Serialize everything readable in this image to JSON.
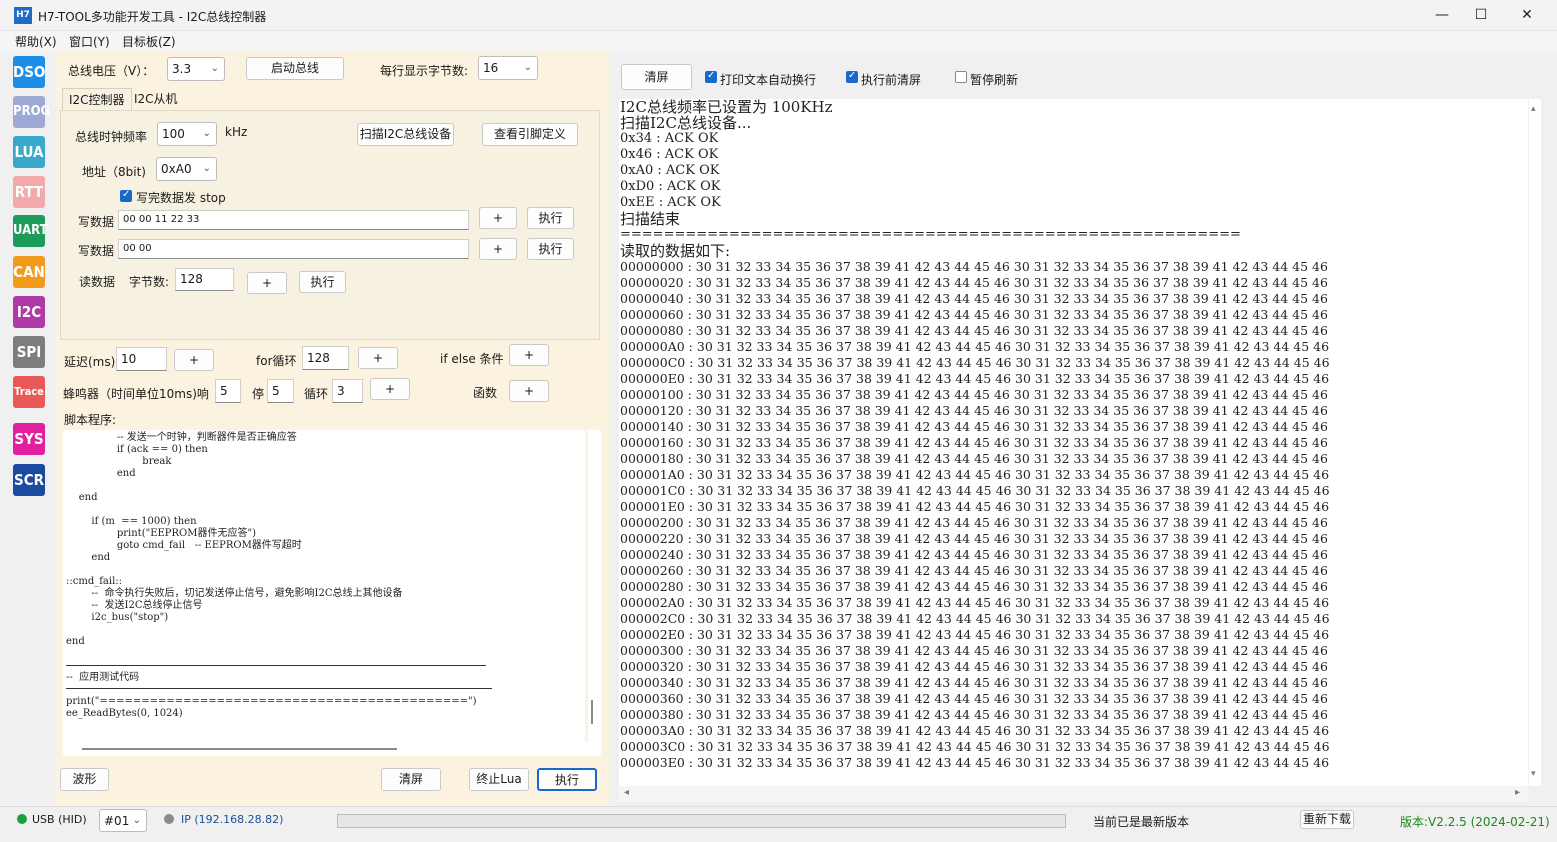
{
  "window": {
    "icon_text": "H7",
    "title": "H7-TOOL多功能开发工具 - I2C总线控制器",
    "minimize": "—",
    "maximize": "☐",
    "close": "✕"
  },
  "menu": [
    "帮助(X)",
    "窗口(Y)",
    "目标板(Z)"
  ],
  "sidebar": [
    {
      "label": "DSO",
      "color": "#1b8ee8"
    },
    {
      "label": "PROG",
      "color": "#9ea9d6"
    },
    {
      "label": "LUA",
      "color": "#3aa9c9"
    },
    {
      "label": "RTT",
      "color": "#f2a9a9"
    },
    {
      "label": "UART",
      "color": "#1c9c56"
    },
    {
      "label": "CAN",
      "color": "#f29a1a"
    },
    {
      "label": "I2C",
      "color": "#b03aa5"
    },
    {
      "label": "SPI",
      "color": "#7d7d7d"
    },
    {
      "label": "Trace",
      "color": "#e85a5a"
    },
    {
      "label": "SYS",
      "color": "#e21f9c"
    },
    {
      "label": "SCR",
      "color": "#1b4aa0"
    }
  ],
  "top": {
    "voltage_label": "总线电压（V）：",
    "voltage_value": "3.3",
    "start_bus": "启动总线",
    "bytes_per_line_label": "每行显示字节数:",
    "bytes_per_line_value": "16"
  },
  "tabs": [
    "I2C控制器",
    "I2C从机"
  ],
  "controller": {
    "clock_label": "总线时钟频率",
    "clock_value": "100",
    "clock_unit": "kHz",
    "scan_button": "扫描I2C总线设备",
    "pin_button": "查看引脚定义",
    "addr_label": "地址（8bit)",
    "addr_value": "0xA0",
    "stop_label": "写完数据发 stop",
    "write1_label": "写数据",
    "write1_value": "00 00 11 22 33",
    "write2_label": "写数据",
    "write2_value": "00 00",
    "read_label": "读数据",
    "read_bytes_label": "字节数:",
    "read_bytes_value": "128",
    "plus": "+",
    "exec": "执行"
  },
  "script_tools": {
    "delay_label": "延迟(ms)",
    "delay_value": "10",
    "for_label": "for循环",
    "for_value": "128",
    "if_label": "if else 条件",
    "buzzer_label": "蜂鸣器（时间单位10ms)响",
    "buzzer_on": "5",
    "stop_label": "停",
    "stop_value": "5",
    "loop_label": "循环",
    "loop_value": "3",
    "func_label": "函数",
    "plus": "+",
    "script_title": "脚本程序:"
  },
  "script_lines": [
    "                -- 发送一个时钟，判断器件是否正确应答",
    "                if (ack == 0) then",
    "                        break",
    "                end",
    "",
    "    end",
    "",
    "        if (m  == 1000) then",
    "                print(\"EEPROM器件无应答\")",
    "                goto cmd_fail   -- EEPROM器件写超时",
    "        end",
    "",
    "::cmd_fail::",
    "        --  命令执行失败后，切记发送停止信号，避免影响I2C总线上其他设备",
    "        --  发送I2C总线停止信号",
    "        i2c_bus(\"stop\")",
    "",
    "end",
    "",
    "",
    "--  应用测试代码",
    "",
    "print(\"============================================\")",
    "ee_ReadBytes(0, 1024)"
  ],
  "bottom_left": {
    "wave": "波形",
    "clear": "清屏",
    "stop_lua": "终止Lua",
    "exec": "执行"
  },
  "output_toolbar": {
    "clear": "清屏",
    "wrap": "打印文本自动换行",
    "clear_before": "执行前清屏",
    "pause": "暂停刷新"
  },
  "output_header": [
    "I2C总线频率已设置为 100KHz",
    "扫描I2C总线设备...",
    "0x34 : ACK OK",
    "0x46 : ACK OK",
    "0xA0 : ACK OK",
    "0xD0 : ACK OK",
    "0xEE : ACK OK",
    "扫描结束",
    "=========================================================",
    "读取的数据如下:"
  ],
  "hex_bytes": "30 31 32 33 34 35 36 37 38 39 41 42 43 44 45 46 30 31 32 33 34 35 36 37 38 39 41 42 43 44 45 46",
  "hex_addresses": [
    "00000000",
    "00000020",
    "00000040",
    "00000060",
    "00000080",
    "000000A0",
    "000000C0",
    "000000E0",
    "00000100",
    "00000120",
    "00000140",
    "00000160",
    "00000180",
    "000001A0",
    "000001C0",
    "000001E0",
    "00000200",
    "00000220",
    "00000240",
    "00000260",
    "00000280",
    "000002A0",
    "000002C0",
    "000002E0",
    "00000300",
    "00000320",
    "00000340",
    "00000360",
    "00000380",
    "000003A0",
    "000003C0",
    "000003E0"
  ],
  "status": {
    "usb": "USB (HID)",
    "device": "#01",
    "ip": "IP (192.168.28.82)",
    "update_msg": "当前已是最新版本",
    "redownload": "重新下载",
    "version": "版本:V2.2.5 (2024-02-21)",
    "usb_color": "#1aa33a",
    "ip_color": "#8a8a8a",
    "version_color": "#1a8a1a"
  }
}
